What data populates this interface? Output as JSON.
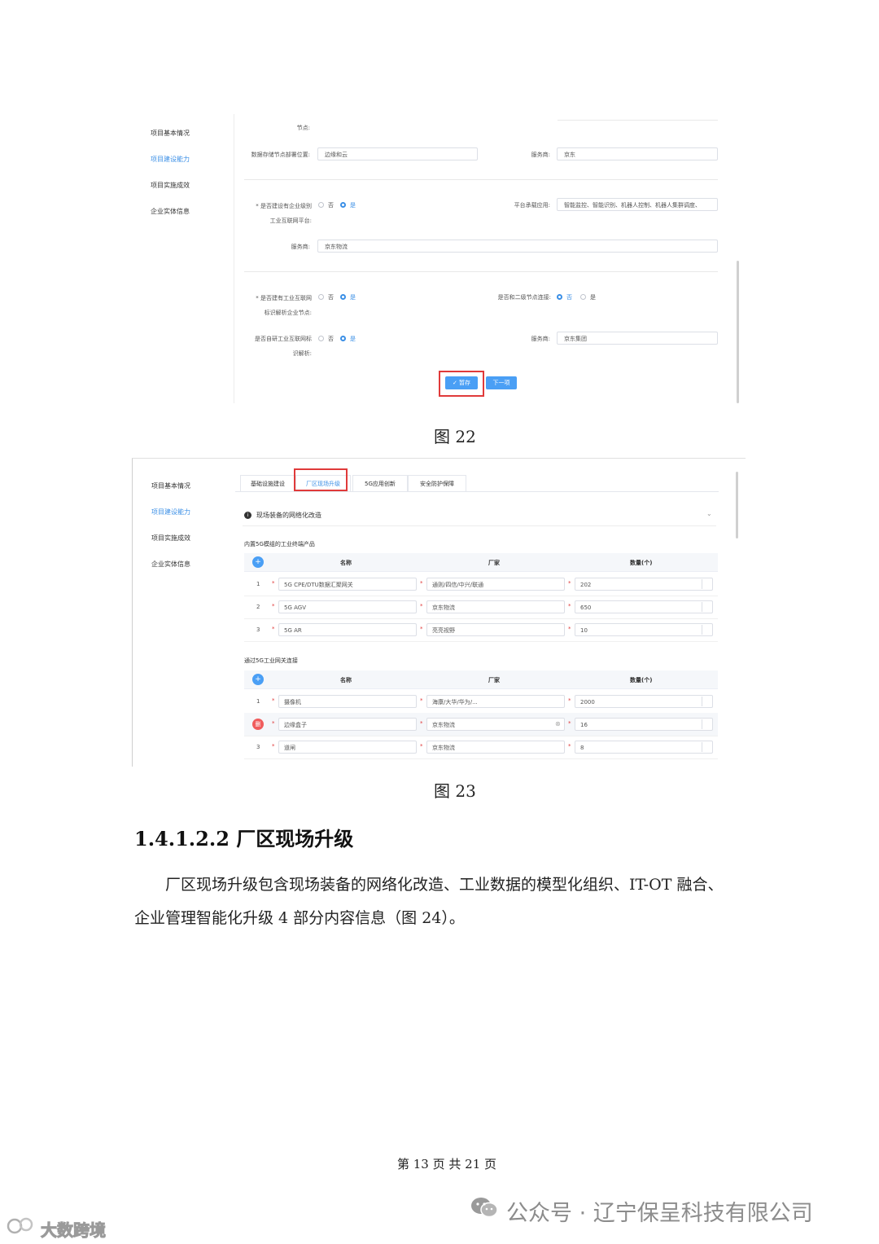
{
  "fig22": {
    "sidebar": [
      "项目基本情况",
      "项目建设能力",
      "项目实施成效",
      "企业实体信息"
    ],
    "row0": {
      "label": "节点:"
    },
    "row1": {
      "label": "数据存储节点部署位置:",
      "value": "边缘和云",
      "label2": "服务商:",
      "value2": "京东"
    },
    "row2": {
      "label_line1": "* 是否建设有企业级别",
      "label_line2": "工业互联网平台:",
      "opt_no": "否",
      "opt_yes": "是",
      "label2": "平台承载应用:",
      "value2": "智能监控、智能识别、机器人控制、机器人集群调度、"
    },
    "row3": {
      "label": "服务商:",
      "value": "京东物流"
    },
    "row4": {
      "label_line1": "* 是否建有工业互联网",
      "label_line2": "标识解析企业节点:",
      "opt_no": "否",
      "opt_yes": "是",
      "label2": "是否和二级节点连接:",
      "opt2_no": "否",
      "opt2_yes": "是"
    },
    "row5": {
      "label_line1": "是否自研工业互联网标",
      "label_line2": "识解析:",
      "opt_no": "否",
      "opt_yes": "是",
      "label2": "服务商:",
      "value2": "京东集团"
    },
    "save_btn": "✓ 暂存",
    "next_btn": "下一项",
    "caption": "图 22"
  },
  "fig23": {
    "sidebar": [
      "项目基本情况",
      "项目建设能力",
      "项目实施成效",
      "企业实体信息"
    ],
    "tabs": [
      "基础设施建设",
      "厂区现场升级",
      "5G应用创新",
      "安全防护保障"
    ],
    "section_title": "现场装备的网络化改造",
    "table1": {
      "title": "内置5G模组的工业终端产品",
      "headers": [
        "名称",
        "厂家",
        "数量(个)"
      ],
      "rows": [
        {
          "idx": "1",
          "name": "5G CPE/DTU数据汇聚网关",
          "maker": "通则/四信/中兴/联通",
          "qty": "202"
        },
        {
          "idx": "2",
          "name": "5G AGV",
          "maker": "京东物流",
          "qty": "650"
        },
        {
          "idx": "3",
          "name": "5G AR",
          "maker": "亮亮视野",
          "qty": "10"
        }
      ]
    },
    "table2": {
      "title": "通过5G工业网关连接",
      "headers": [
        "名称",
        "厂家",
        "数量(个)"
      ],
      "rows": [
        {
          "idx": "1",
          "name": "摄像机",
          "maker": "海康/大华/华为/...",
          "qty": "2000"
        },
        {
          "idx": "",
          "name": "边缘盒子",
          "maker": "京东物流",
          "qty": "16"
        },
        {
          "idx": "3",
          "name": "道闸",
          "maker": "京东物流",
          "qty": "8"
        }
      ]
    },
    "caption": "图 23"
  },
  "section": {
    "heading": "1.4.1.2.2 厂区现场升级",
    "para_line1": "厂区现场升级包含现场装备的网络化改造、工业数据的模型化组织、IT-OT 融合、",
    "para_line2": "企业管理智能化升级 4 部分内容信息（图 24）。"
  },
  "footer": {
    "text": "第 13 页 共 21 页"
  },
  "watermarks": {
    "right": "公众号 · 辽宁保呈科技有限公司",
    "left": "大数跨境"
  },
  "colors": {
    "accent": "#3b8fe6",
    "red": "#e03a3a",
    "button": "#4a9ff5"
  }
}
